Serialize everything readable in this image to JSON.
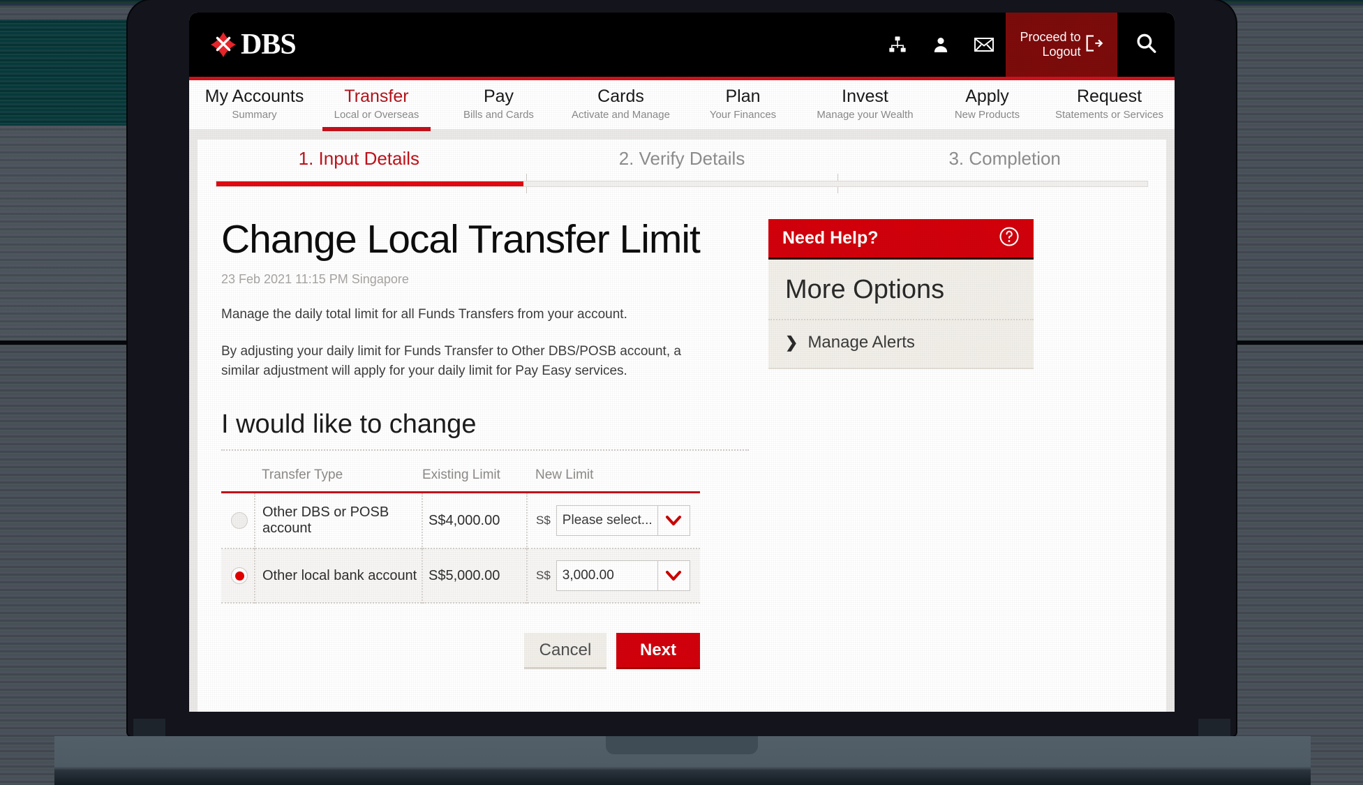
{
  "brand": {
    "name": "DBS",
    "logo_icon": "dbs-star-icon",
    "accent_red": "#d2000b",
    "header_red": "#7d0b0b"
  },
  "topbar": {
    "icons": [
      {
        "name": "sitemap-icon",
        "glyph": "sitemap"
      },
      {
        "name": "person-icon",
        "glyph": "person"
      },
      {
        "name": "envelope-icon",
        "glyph": "envelope"
      }
    ],
    "logout": {
      "line1": "Proceed to",
      "line2": "Logout",
      "icon": "logout-icon"
    },
    "search": {
      "icon": "search-icon"
    }
  },
  "nav": {
    "items": [
      {
        "title": "My Accounts",
        "sub": "Summary",
        "active": false
      },
      {
        "title": "Transfer",
        "sub": "Local or Overseas",
        "active": true
      },
      {
        "title": "Pay",
        "sub": "Bills and Cards",
        "active": false
      },
      {
        "title": "Cards",
        "sub": "Activate and Manage",
        "active": false
      },
      {
        "title": "Plan",
        "sub": "Your Finances",
        "active": false
      },
      {
        "title": "Invest",
        "sub": "Manage your Wealth",
        "active": false
      },
      {
        "title": "Apply",
        "sub": "New Products",
        "active": false
      },
      {
        "title": "Request",
        "sub": "Statements or Services",
        "active": false
      }
    ]
  },
  "steps": {
    "items": [
      {
        "label": "1. Input Details",
        "active": true
      },
      {
        "label": "2. Verify Details",
        "active": false
      },
      {
        "label": "3. Completion",
        "active": false
      }
    ],
    "progress_percent": 33
  },
  "main": {
    "title": "Change Local Transfer Limit",
    "date": "23 Feb 2021 11:15 PM Singapore",
    "paragraph1": "Manage the daily total limit for all Funds Transfers from your account.",
    "paragraph2": "By adjusting your daily limit for Funds Transfer to Other DBS/POSB account, a similar adjustment will apply for your daily limit for Pay Easy services.",
    "section_title": "I would like to change",
    "table": {
      "headers": [
        "Transfer Type",
        "Existing Limit",
        "New Limit"
      ],
      "currency_prefix": "S$",
      "rows": [
        {
          "selected": false,
          "type": "Other DBS or POSB account",
          "existing_limit": "S$4,000.00",
          "new_limit": "Please select...",
          "new_limit_is_placeholder": true
        },
        {
          "selected": true,
          "type": "Other local bank account",
          "existing_limit": "S$5,000.00",
          "new_limit": "3,000.00",
          "new_limit_is_placeholder": false
        }
      ]
    },
    "buttons": {
      "cancel": "Cancel",
      "next": "Next"
    }
  },
  "sidebar": {
    "help_title": "Need Help?",
    "help_icon": "question-circle-icon",
    "more_options_title": "More Options",
    "links": [
      {
        "label": "Manage Alerts",
        "icon": "chevron-right-icon"
      }
    ]
  }
}
